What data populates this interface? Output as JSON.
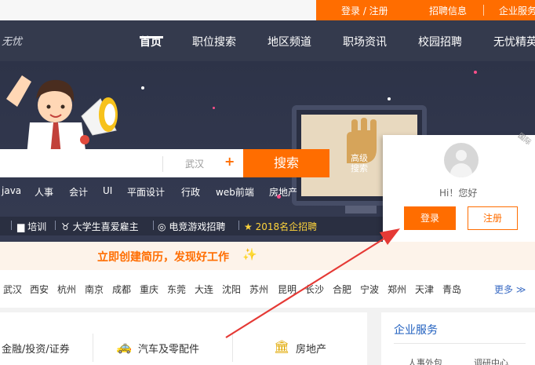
{
  "top_bar": {
    "login_register": "登录 / 注册",
    "recruit_info": "招聘信息",
    "enterprise_service": "企业服务"
  },
  "header": {
    "logo_text": "无忧",
    "nav": [
      {
        "label": "首页",
        "active": true
      },
      {
        "label": "职位搜索"
      },
      {
        "label": "地区频道"
      },
      {
        "label": "职场资讯"
      },
      {
        "label": "校园招聘"
      },
      {
        "label": "无忧精英"
      }
    ]
  },
  "search": {
    "city": "武汉",
    "city_add_symbol": "+",
    "button_label": "搜索",
    "advanced_line1": "高级",
    "advanced_line2": "搜索"
  },
  "hot_tags": [
    "java",
    "人事",
    "会计",
    "UI",
    "平面设计",
    "行政",
    "web前端",
    "房地产"
  ],
  "ribbon": [
    {
      "icon": "book-icon",
      "label": "培训"
    },
    {
      "icon": "medal-icon",
      "label": "大学生喜爱雇主"
    },
    {
      "icon": "gamepad-icon",
      "label": "电竞游戏招聘"
    },
    {
      "icon": "star-icon",
      "label": "2018名企招聘"
    }
  ],
  "login_panel": {
    "greeting": "Hi！您好",
    "login_button": "登录",
    "register_button": "注册",
    "corner_tag": "国际"
  },
  "resume_banner": {
    "text": "立即创建简历，发现好工作"
  },
  "cities": [
    "武汉",
    "西安",
    "杭州",
    "南京",
    "成都",
    "重庆",
    "东莞",
    "大连",
    "沈阳",
    "苏州",
    "昆明",
    "长沙",
    "合肥",
    "宁波",
    "郑州",
    "天津",
    "青岛"
  ],
  "more_link": "更多 ≫",
  "categories": [
    {
      "label": "金融/投资/证券"
    },
    {
      "icon": "car-icon",
      "label": "汽车及零配件"
    },
    {
      "icon": "bank-icon",
      "label": "房地产"
    }
  ],
  "enterprise_panel": {
    "title": "企业服务",
    "items": [
      "人事外包",
      "调研中心"
    ]
  },
  "colors": {
    "accent": "#ff6d00",
    "nav_bg": "#343a4d",
    "link_blue": "#1f5fbf",
    "annotation_arrow": "#e53935"
  }
}
